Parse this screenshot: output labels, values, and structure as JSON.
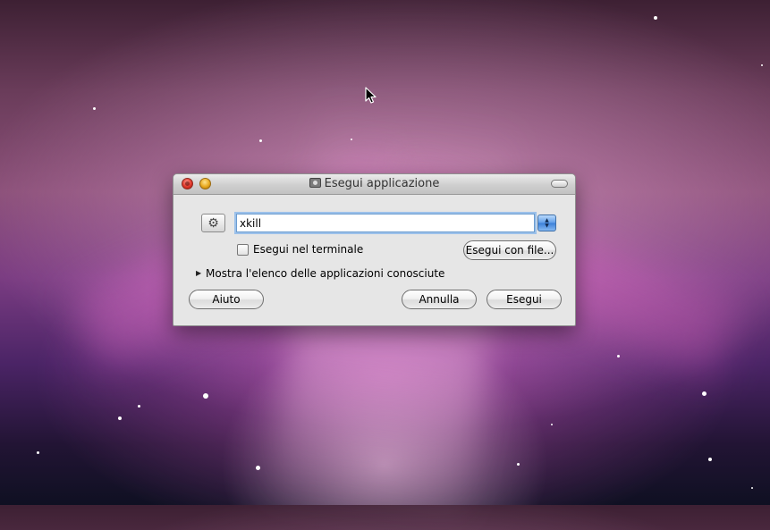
{
  "window": {
    "title": "Esegui applicazione",
    "title_icon": "terminal-icon"
  },
  "form": {
    "app_icon": "gear-icon",
    "command_value": "xkill",
    "run_in_terminal_label": "Esegui nel terminale",
    "run_in_terminal_checked": false,
    "run_with_file_label": "Esegui con file...",
    "show_known_apps_label": "Mostra l'elenco delle applicazioni conosciute"
  },
  "buttons": {
    "help_label": "Aiuto",
    "cancel_label": "Annulla",
    "run_label": "Esegui"
  },
  "colors": {
    "focus_ring": "#9cc1ea",
    "combo_accent": "#3b7fd8",
    "close_red": "#e0372a",
    "minimize_yellow": "#e8a81d"
  }
}
